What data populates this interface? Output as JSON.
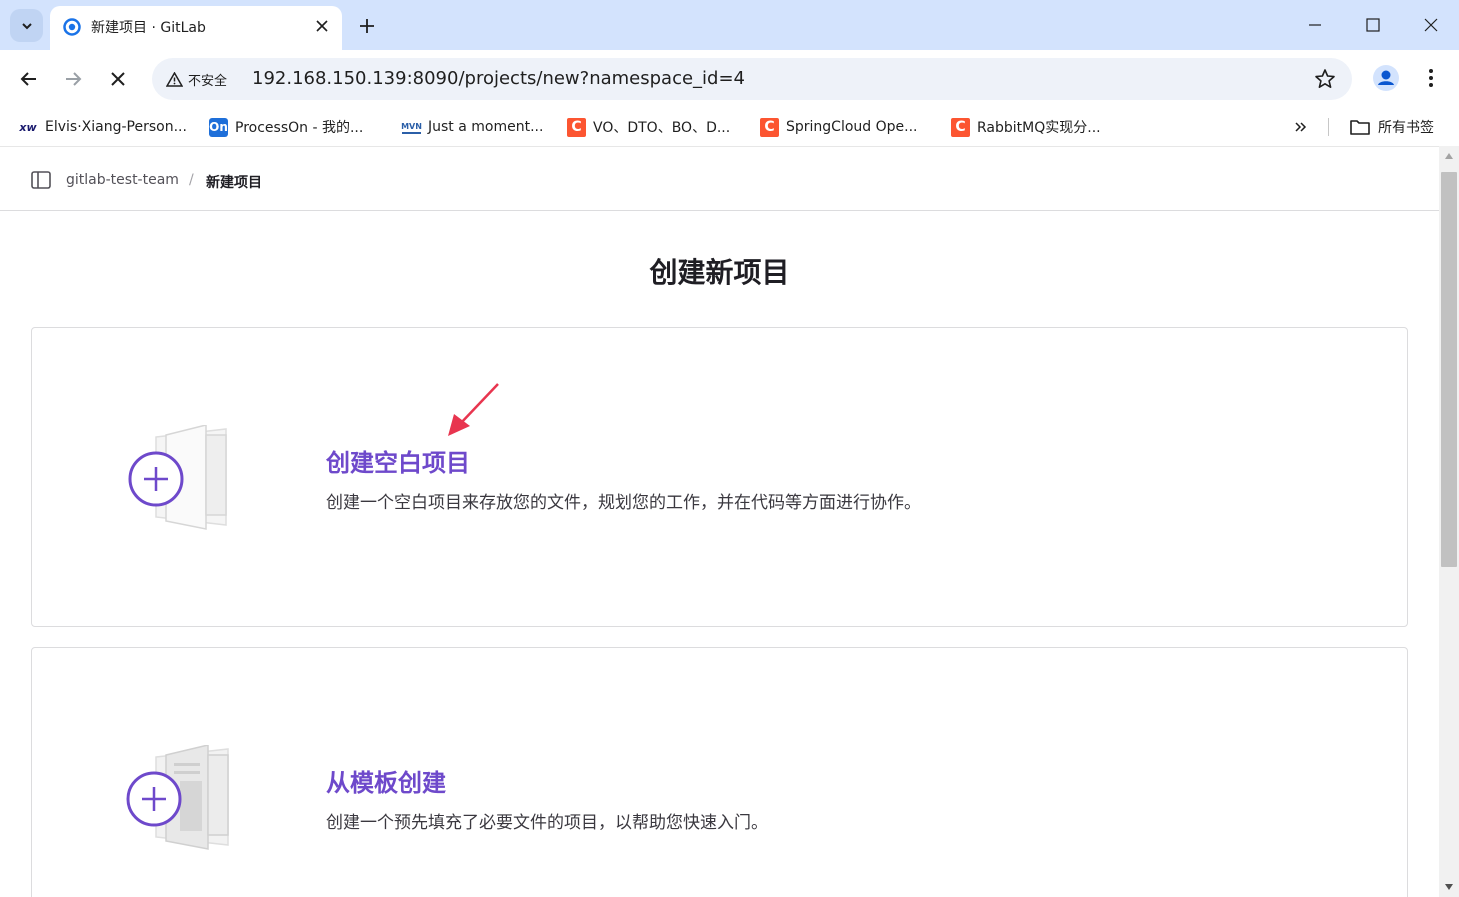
{
  "browser": {
    "tab": {
      "title": "新建项目 · GitLab",
      "favicon": "gitlab-circle-icon"
    },
    "address_bar": {
      "security_label": "不安全",
      "url": "192.168.150.139:8090/projects/new?namespace_id=4"
    },
    "bookmarks": [
      {
        "label": "Elvis·Xiang-Person...",
        "icon": "xw-icon",
        "icon_text": "xw"
      },
      {
        "label": "ProcessOn - 我的...",
        "icon": "processon-icon",
        "icon_text": "On"
      },
      {
        "label": "Just a moment...",
        "icon": "mvn-icon",
        "icon_text": "MVN"
      },
      {
        "label": "VO、DTO、BO、D...",
        "icon": "csdn-icon",
        "icon_text": "C"
      },
      {
        "label": "SpringCloud Ope...",
        "icon": "csdn-icon",
        "icon_text": "C"
      },
      {
        "label": "RabbitMQ实现分...",
        "icon": "csdn-icon",
        "icon_text": "C"
      }
    ],
    "all_bookmarks_label": "所有书签"
  },
  "page": {
    "breadcrumb": {
      "parent": "gitlab-test-team",
      "separator": "/",
      "current": "新建项目"
    },
    "title": "创建新项目",
    "options": [
      {
        "title": "创建空白项目",
        "description": "创建一个空白项目来存放您的文件，规划您的工作，并在代码等方面进行协作。"
      },
      {
        "title": "从模板创建",
        "description": "创建一个预先填充了必要文件的项目，以帮助您快速入门。"
      }
    ]
  },
  "colors": {
    "tabstrip": "#d3e3fd",
    "accent_purple": "#6e49cb",
    "annotation_arrow": "#e8354f",
    "csdn_red": "#fc5531"
  }
}
